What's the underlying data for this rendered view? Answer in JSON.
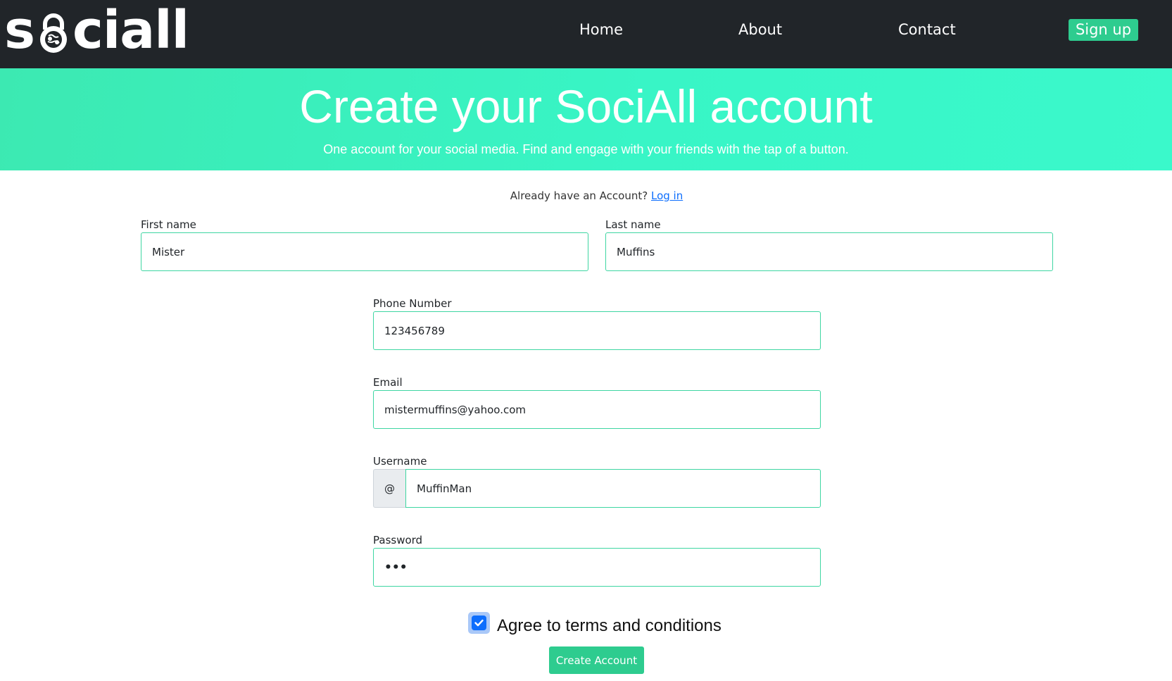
{
  "navbar": {
    "logo_text_left": "s",
    "logo_text_right": "ciall",
    "links": {
      "home": "Home",
      "about": "About",
      "contact": "Contact"
    },
    "signup_label": "Sign up"
  },
  "hero": {
    "title": "Create your SociAll account",
    "subtitle": "One account for your social media. Find and engage with your friends with the tap of a button."
  },
  "form": {
    "already_text": "Already have an Account?",
    "login_link": "Log in",
    "first_name": {
      "label": "First name",
      "value": "Mister"
    },
    "last_name": {
      "label": "Last name",
      "value": "Muffins"
    },
    "phone": {
      "label": "Phone Number",
      "value": "123456789"
    },
    "email": {
      "label": "Email",
      "value": "mistermuffins@yahoo.com"
    },
    "username": {
      "label": "Username",
      "prefix": "@",
      "value": "MuffinMan"
    },
    "password": {
      "label": "Password",
      "value": "•••"
    },
    "terms": {
      "label": "Agree to terms and conditions",
      "checked": true
    },
    "submit_label": "Create Account"
  },
  "colors": {
    "navbar_bg": "#212529",
    "accent": "#2ecc8f",
    "hero_bg": "#38f5c6",
    "field_border": "#3ed6a2",
    "checkbox": "#0d6efd"
  }
}
